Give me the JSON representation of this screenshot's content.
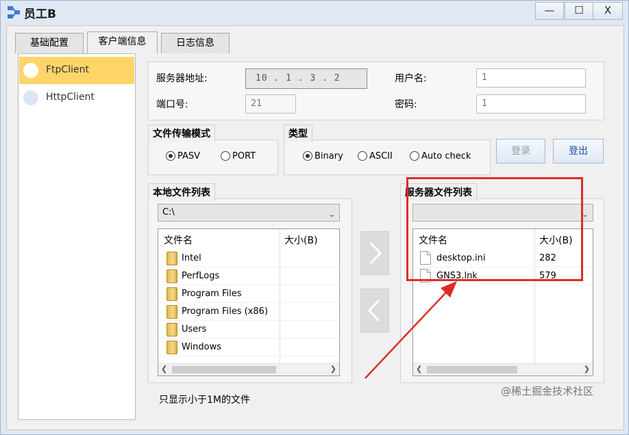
{
  "window": {
    "title": "员工B",
    "controls": {
      "minimize": "—",
      "maximize": "☐",
      "close": "X"
    }
  },
  "tabs": [
    {
      "label": "基础配置",
      "active": false
    },
    {
      "label": "客户端信息",
      "active": true
    },
    {
      "label": "日志信息",
      "active": false
    }
  ],
  "sidebar": {
    "items": [
      {
        "label": "FtpClient",
        "selected": true
      },
      {
        "label": "HttpClient",
        "selected": false
      }
    ]
  },
  "connection": {
    "server_address_label": "服务器地址:",
    "server_address_value": "10 . 1 . 3 . 2",
    "port_label": "端口号:",
    "port_value": "21",
    "username_label": "用户名:",
    "username_value": "1",
    "password_label": "密码:",
    "password_value": "1"
  },
  "transfer_mode": {
    "title": "文件传输模式",
    "options": [
      {
        "label": "PASV",
        "checked": true
      },
      {
        "label": "PORT",
        "checked": false
      }
    ]
  },
  "type_group": {
    "title": "类型",
    "options": [
      {
        "label": "Binary",
        "checked": true
      },
      {
        "label": "ASCII",
        "checked": false
      },
      {
        "label": "Auto check",
        "checked": false
      }
    ]
  },
  "buttons": {
    "login": "登录",
    "logout": "登出"
  },
  "local_files": {
    "title": "本地文件列表",
    "path": "C:\\",
    "columns": [
      "文件名",
      "大小(B)"
    ],
    "rows": [
      {
        "name": "Intel",
        "size": ""
      },
      {
        "name": "PerfLogs",
        "size": ""
      },
      {
        "name": "Program Files",
        "size": ""
      },
      {
        "name": "Program Files (x86)",
        "size": ""
      },
      {
        "name": "Users",
        "size": ""
      },
      {
        "name": "Windows",
        "size": ""
      }
    ]
  },
  "server_files": {
    "title": "服务器文件列表",
    "path": "",
    "columns": [
      "文件名",
      "大小(B)"
    ],
    "rows": [
      {
        "name": "desktop.ini",
        "size": "282"
      },
      {
        "name": "GNS3.lnk",
        "size": "579"
      }
    ]
  },
  "note": "只显示小于1M的文件",
  "watermark": "@稀土掘金技术社区",
  "colors": {
    "highlight_red": "#e02a2a",
    "sidebar_selected": "#ffd56a"
  }
}
